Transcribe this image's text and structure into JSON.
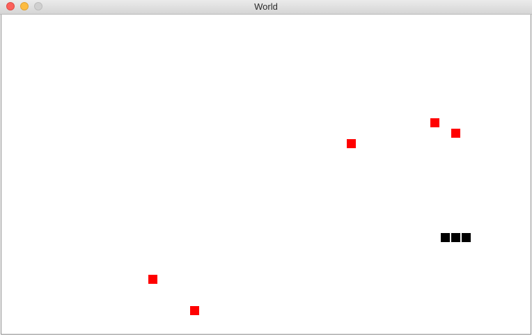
{
  "window": {
    "title": "World"
  },
  "colors": {
    "food": "#ff0000",
    "snake": "#000000",
    "background": "#ffffff"
  },
  "game": {
    "cell_size": 15,
    "food": [
      {
        "col": 41,
        "row": 10
      },
      {
        "col": 43,
        "row": 11
      },
      {
        "col": 33,
        "row": 12
      },
      {
        "col": 14,
        "row": 25
      },
      {
        "col": 18,
        "row": 28
      }
    ],
    "snake": [
      {
        "col": 42,
        "row": 21
      },
      {
        "col": 43,
        "row": 21
      },
      {
        "col": 44,
        "row": 21
      }
    ]
  }
}
